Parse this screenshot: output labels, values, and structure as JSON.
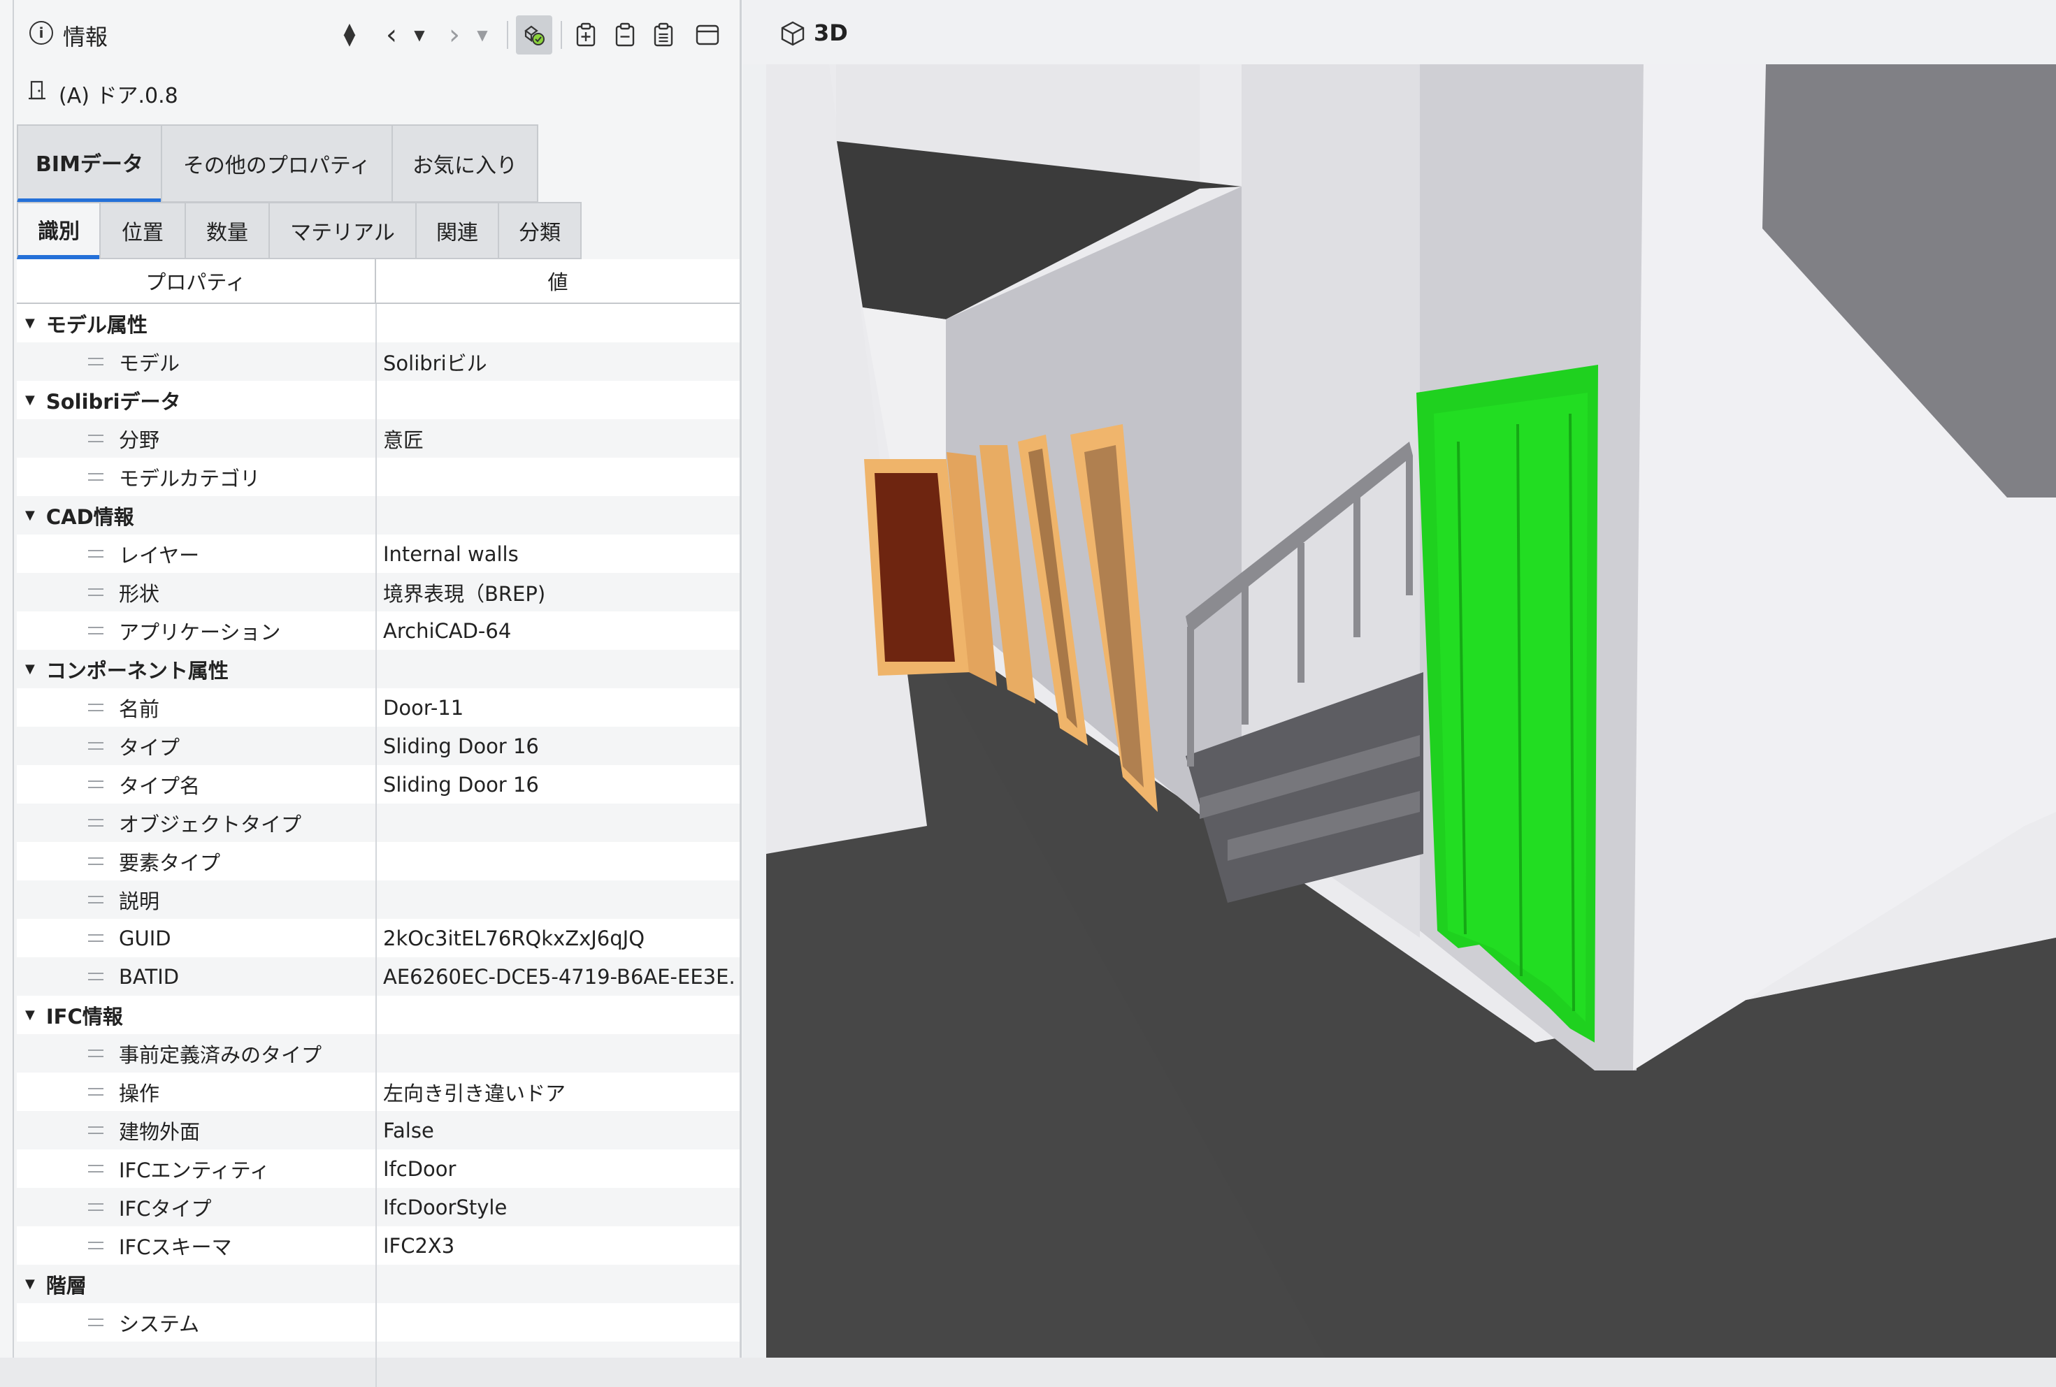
{
  "panel": {
    "title": "情報",
    "toolbar": {
      "sort": "▲▼",
      "back": "‹",
      "back_dropdown": "▼",
      "forward": "›",
      "forward_dropdown": "▼"
    },
    "selected_object": "(A) ドア.0.8"
  },
  "main_tabs": [
    {
      "label": "BIMデータ",
      "active": true
    },
    {
      "label": "その他のプロパティ",
      "active": false
    },
    {
      "label": "お気に入り",
      "active": false
    }
  ],
  "sub_tabs": [
    {
      "label": "識別",
      "active": true
    },
    {
      "label": "位置",
      "active": false
    },
    {
      "label": "数量",
      "active": false
    },
    {
      "label": "マテリアル",
      "active": false
    },
    {
      "label": "関連",
      "active": false
    },
    {
      "label": "分類",
      "active": false
    }
  ],
  "table": {
    "col_property": "プロパティ",
    "col_value": "値",
    "groups": [
      {
        "name": "モデル属性",
        "rows": [
          {
            "prop": "モデル",
            "value": "Solibriビル"
          }
        ]
      },
      {
        "name": "Solibriデータ",
        "rows": [
          {
            "prop": "分野",
            "value": "意匠"
          },
          {
            "prop": "モデルカテゴリ",
            "value": ""
          }
        ]
      },
      {
        "name": "CAD情報",
        "rows": [
          {
            "prop": "レイヤー",
            "value": "Internal walls"
          },
          {
            "prop": "形状",
            "value": "境界表現（BREP)"
          },
          {
            "prop": "アプリケーション",
            "value": "ArchiCAD-64"
          }
        ]
      },
      {
        "name": "コンポーネント属性",
        "rows": [
          {
            "prop": "名前",
            "value": "Door-11"
          },
          {
            "prop": "タイプ",
            "value": "Sliding Door 16"
          },
          {
            "prop": "タイプ名",
            "value": "Sliding Door 16"
          },
          {
            "prop": "オブジェクトタイプ",
            "value": ""
          },
          {
            "prop": "要素タイプ",
            "value": ""
          },
          {
            "prop": "説明",
            "value": ""
          },
          {
            "prop": "GUID",
            "value": "2kOc3itEL76RQkxZxJ6qJQ"
          },
          {
            "prop": "BATID",
            "value": "AE6260EC-DCE5-4719-B6AE-EE3E..."
          }
        ]
      },
      {
        "name": "IFC情報",
        "rows": [
          {
            "prop": "事前定義済みのタイプ",
            "value": ""
          },
          {
            "prop": "操作",
            "value": "左向き引き違いドア"
          },
          {
            "prop": "建物外面",
            "value": "False"
          },
          {
            "prop": "IFCエンティティ",
            "value": "IfcDoor"
          },
          {
            "prop": "IFCタイプ",
            "value": "IfcDoorStyle"
          },
          {
            "prop": "IFCスキーマ",
            "value": "IFC2X3"
          }
        ]
      },
      {
        "name": "階層",
        "rows": [
          {
            "prop": "システム",
            "value": ""
          }
        ]
      }
    ]
  },
  "view": {
    "title": "3D"
  },
  "colors": {
    "accent": "#2470d8",
    "selected_door": "#1fd11f",
    "floor": "#474747",
    "ceiling": "#3b3b3b",
    "wall_light": "#e6e6ea",
    "wall_mid": "#c4c4ca",
    "door_wood": "#efb46a",
    "door_dark": "#6e2510"
  }
}
